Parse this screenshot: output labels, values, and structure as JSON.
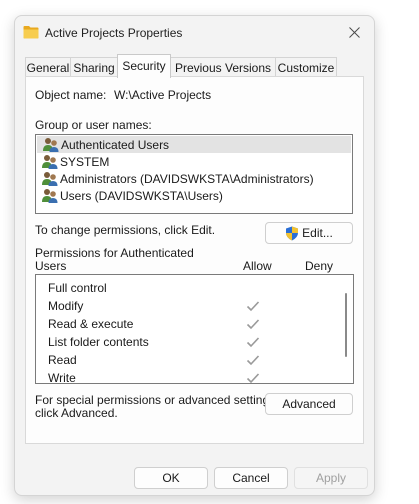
{
  "window": {
    "title": "Active Projects Properties"
  },
  "tabs": [
    {
      "label": "General"
    },
    {
      "label": "Sharing"
    },
    {
      "label": "Security"
    },
    {
      "label": "Previous Versions"
    },
    {
      "label": "Customize"
    }
  ],
  "security": {
    "object_name_label": "Object name:",
    "object_name_value": "W:\\Active Projects",
    "group_label": "Group or user names:",
    "groups": [
      {
        "name": "Authenticated Users",
        "selected": true
      },
      {
        "name": "SYSTEM",
        "selected": false
      },
      {
        "name": "Administrators (DAVIDSWKSTA\\Administrators)",
        "selected": false
      },
      {
        "name": "Users (DAVIDSWKSTA\\Users)",
        "selected": false
      }
    ],
    "change_hint": "To change permissions, click Edit.",
    "edit_button": "Edit...",
    "perm_header_line1": "Permissions for Authenticated",
    "perm_header_line2": "Users",
    "allow_header": "Allow",
    "deny_header": "Deny",
    "permissions": [
      {
        "name": "Full control",
        "allow": false,
        "deny": false
      },
      {
        "name": "Modify",
        "allow": true,
        "deny": false
      },
      {
        "name": "Read & execute",
        "allow": true,
        "deny": false
      },
      {
        "name": "List folder contents",
        "allow": true,
        "deny": false
      },
      {
        "name": "Read",
        "allow": true,
        "deny": false
      },
      {
        "name": "Write",
        "allow": true,
        "deny": false
      }
    ],
    "advanced_hint_line1": "For special permissions or advanced settings,",
    "advanced_hint_line2": "click Advanced.",
    "advanced_button": "Advanced"
  },
  "footer": {
    "ok": "OK",
    "cancel": "Cancel",
    "apply": "Apply"
  },
  "colors": {
    "check": "#9a9a9a",
    "folder": "#f5c342",
    "shield_blue": "#2a6fd6",
    "shield_yellow": "#f2c230"
  }
}
